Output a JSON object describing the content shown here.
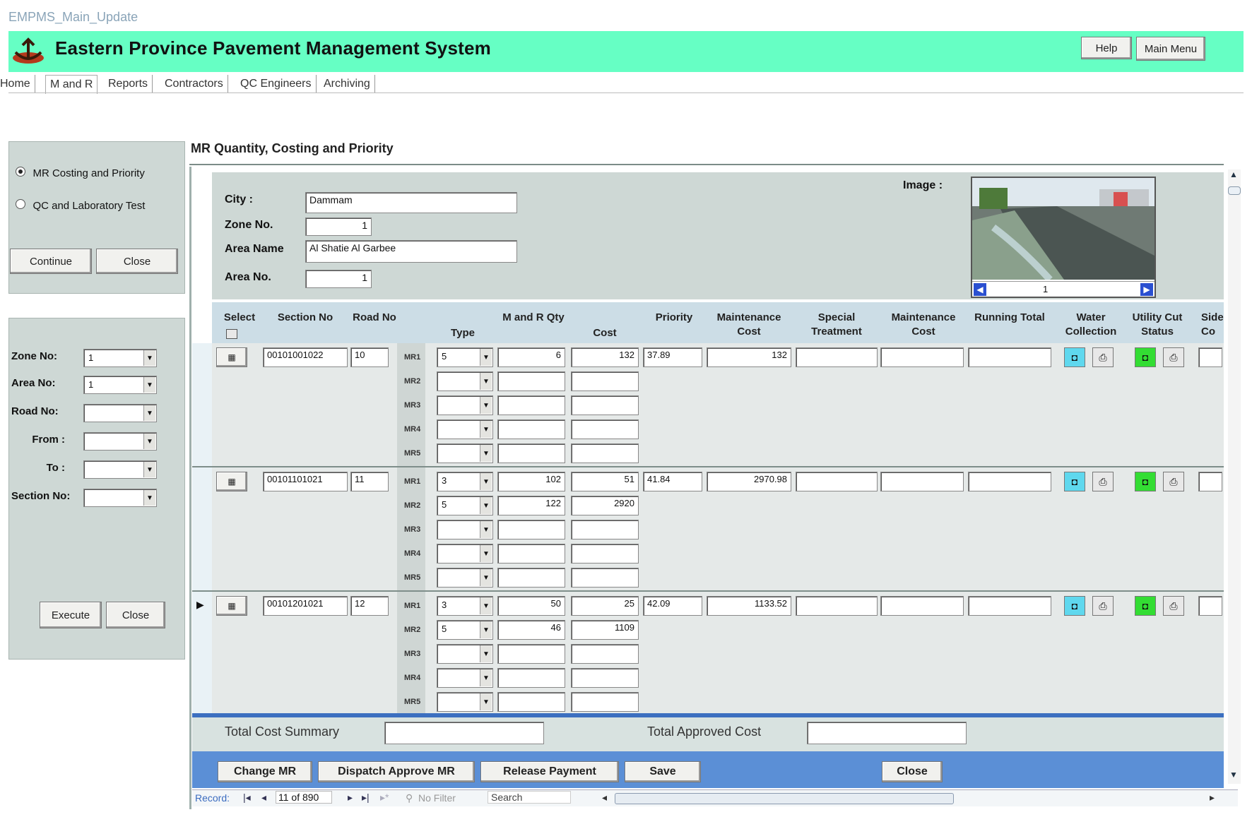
{
  "window": {
    "title": "EMPMS_Main_Update"
  },
  "app": {
    "title": "Eastern Province Pavement Management System",
    "help_label": "Help",
    "main_menu_label": "Main Menu"
  },
  "tabs": [
    "Home",
    "M and R",
    "Reports",
    "Contractors",
    "QC Engineers",
    "Archiving"
  ],
  "left_panel": {
    "options": [
      "MR Costing and Priority",
      "QC and Laboratory Test"
    ],
    "continue_label": "Continue",
    "close_label": "Close"
  },
  "filter_panel": {
    "labels": [
      "Zone No:",
      "Area No:",
      "Road No:",
      "From :",
      "To :",
      "Section No:"
    ],
    "values": [
      "1",
      "1",
      "",
      "",
      "",
      ""
    ],
    "execute_label": "Execute",
    "close_label": "Close"
  },
  "main": {
    "title": "MR Quantity, Costing and Priority",
    "city_label": "City :",
    "city_value": "Dammam",
    "zone_label": "Zone No.",
    "zone_value": "1",
    "area_name_label": "Area Name",
    "area_name_value": "Al Shatie Al Garbee",
    "area_no_label": "Area No.",
    "area_no_value": "1",
    "image_label": "Image :",
    "image_nav_value": "1"
  },
  "columns": [
    "Select",
    "Section No",
    "Road No",
    "Type",
    "M and R Qty",
    "Cost",
    "Priority",
    "Maintenance Cost",
    "Special Treatment",
    "Maintenance Cost",
    "Running Total",
    "Water Collection",
    "Utility Cut Status",
    "Side Co"
  ],
  "mr_labels": [
    "MR1",
    "MR2",
    "MR3",
    "MR4",
    "MR5"
  ],
  "rows": [
    {
      "section": "00101001022",
      "road": "10",
      "priority": "37.89",
      "maint_cost": "132",
      "mr": [
        {
          "type": "5",
          "qty": "6",
          "cost": "132"
        },
        {
          "type": "",
          "qty": "",
          "cost": ""
        },
        {
          "type": "",
          "qty": "",
          "cost": ""
        },
        {
          "type": "",
          "qty": "",
          "cost": ""
        },
        {
          "type": "",
          "qty": "",
          "cost": ""
        }
      ]
    },
    {
      "section": "00101101021",
      "road": "11",
      "priority": "41.84",
      "maint_cost": "2970.98",
      "mr": [
        {
          "type": "3",
          "qty": "102",
          "cost": "51"
        },
        {
          "type": "5",
          "qty": "122",
          "cost": "2920"
        },
        {
          "type": "",
          "qty": "",
          "cost": ""
        },
        {
          "type": "",
          "qty": "",
          "cost": ""
        },
        {
          "type": "",
          "qty": "",
          "cost": ""
        }
      ]
    },
    {
      "section": "00101201021",
      "road": "12",
      "priority": "42.09",
      "maint_cost": "1133.52",
      "mr": [
        {
          "type": "3",
          "qty": "50",
          "cost": "25"
        },
        {
          "type": "5",
          "qty": "46",
          "cost": "1109"
        },
        {
          "type": "",
          "qty": "",
          "cost": ""
        },
        {
          "type": "",
          "qty": "",
          "cost": ""
        },
        {
          "type": "",
          "qty": "",
          "cost": ""
        }
      ]
    }
  ],
  "summary": {
    "total_cost_label": "Total Cost Summary",
    "total_approved_label": "Total Approved Cost"
  },
  "actions": [
    "Change MR",
    "Dispatch Approve MR",
    "Release Payment",
    "Save",
    "Close"
  ],
  "record_nav": {
    "label": "Record:",
    "position": "11 of 890",
    "filter": "No Filter",
    "search": "Search"
  },
  "icons": {
    "water_bg": "#5fd8ee",
    "utility_bg": "#33dd33"
  }
}
